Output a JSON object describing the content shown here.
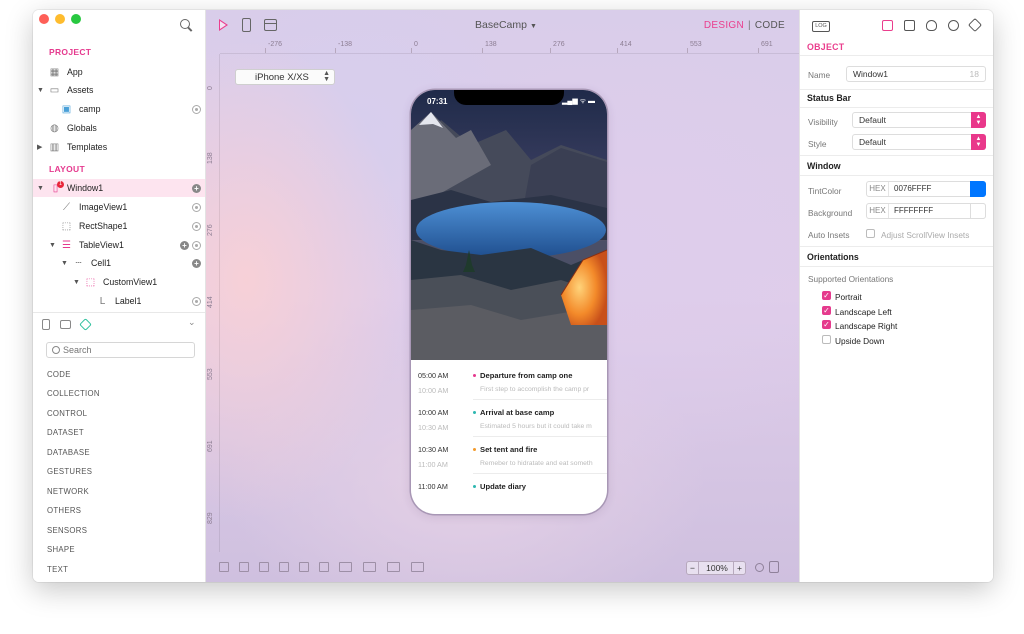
{
  "app": {
    "project_name": "BaseCamp",
    "mode_design": "DESIGN",
    "mode_separator": "|",
    "mode_code": "CODE",
    "accent_color": "#ea3e8d"
  },
  "left_panel": {
    "project_title": "PROJECT",
    "project_items": [
      {
        "label": "App",
        "icon": "app-icon"
      },
      {
        "label": "Assets",
        "icon": "assets-icon"
      },
      {
        "label": "camp",
        "icon": "image-file-icon"
      },
      {
        "label": "Globals",
        "icon": "globe-icon"
      },
      {
        "label": "Templates",
        "icon": "templates-icon"
      }
    ],
    "layout_title": "LAYOUT",
    "layout_items": [
      {
        "label": "Window1",
        "icon": "window-icon",
        "badge": "1"
      },
      {
        "label": "ImageView1",
        "icon": "imageview-icon"
      },
      {
        "label": "RectShape1",
        "icon": "rectshape-icon"
      },
      {
        "label": "TableView1",
        "icon": "tableview-icon"
      },
      {
        "label": "Cell1",
        "icon": "cell-icon"
      },
      {
        "label": "CustomView1",
        "icon": "customview-icon"
      },
      {
        "label": "Label1",
        "icon": "label-icon"
      }
    ],
    "search_placeholder": "Search",
    "categories": [
      "CODE",
      "COLLECTION",
      "CONTROL",
      "DATASET",
      "DATABASE",
      "GESTURES",
      "NETWORK",
      "OTHERS",
      "SENSORS",
      "SHAPE",
      "TEXT"
    ]
  },
  "canvas": {
    "device": "iPhone X/XS",
    "ruler_top": [
      "-276",
      "-138",
      "0",
      "138",
      "276",
      "414",
      "553",
      "691"
    ],
    "ruler_left": [
      "0",
      "138",
      "276",
      "414",
      "553",
      "691",
      "829"
    ],
    "zoom": "100%",
    "zoom_minus": "−",
    "zoom_plus": "+"
  },
  "phone": {
    "time": "07:31",
    "status_icons": "▂▄▆ ᯤ ▬",
    "rows": [
      {
        "time": "05:00 AM",
        "time2": "10:00 AM",
        "title": "Departure from camp one",
        "sub": "First step to accomplish the camp pr",
        "dot_color": "#e5398e"
      },
      {
        "time": "10:00 AM",
        "time2": "10:30 AM",
        "title": "Arrival at base camp",
        "sub": "Estimated 5 hours but it could take m",
        "dot_color": "#2db7b0"
      },
      {
        "time": "10:30 AM",
        "time2": "11:00 AM",
        "title": "Set tent and fire",
        "sub": "Remeber to hidratate and eat someth",
        "dot_color": "#f39a2b"
      },
      {
        "time": "11:00 AM",
        "time2": "",
        "title": "Update diary",
        "sub": "",
        "dot_color": "#2db7b0"
      }
    ]
  },
  "right_panel": {
    "log_label": "LOG",
    "object_title": "OBJECT",
    "name_label": "Name",
    "name_value": "Window1",
    "name_count": "18",
    "status_bar_title": "Status Bar",
    "visibility_label": "Visibility",
    "visibility_value": "Default",
    "style_label": "Style",
    "style_value": "Default",
    "window_title": "Window",
    "tint_label": "TintColor",
    "hex_label": "HEX",
    "tint_value": "0076FFFF",
    "tint_swatch": "#0076ff",
    "background_label": "Background",
    "background_value": "FFFFFFFF",
    "background_swatch": "#ffffff",
    "auto_insets_label": "Auto Insets",
    "adjust_insets_label": "Adjust ScrollView Insets",
    "orientations_title": "Orientations",
    "supported_label": "Supported Orientations",
    "orientations": [
      {
        "label": "Portrait",
        "checked": true
      },
      {
        "label": "Landscape Left",
        "checked": true
      },
      {
        "label": "Landscape Right",
        "checked": true
      },
      {
        "label": "Upside Down",
        "checked": false
      }
    ]
  }
}
